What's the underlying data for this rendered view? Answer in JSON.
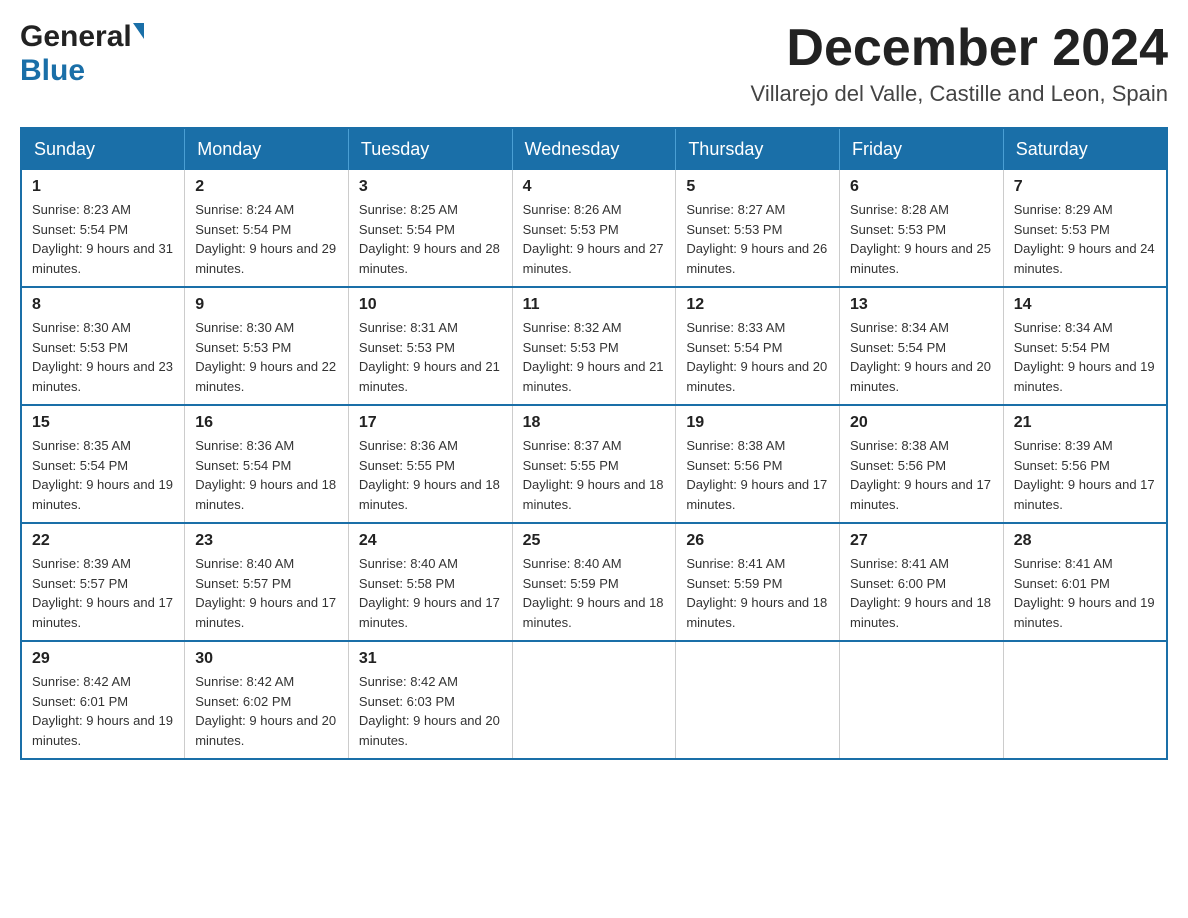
{
  "header": {
    "logo_general": "General",
    "logo_flag_symbol": "▶",
    "logo_blue": "Blue",
    "month_title": "December 2024",
    "location": "Villarejo del Valle, Castille and Leon, Spain"
  },
  "weekdays": [
    "Sunday",
    "Monday",
    "Tuesday",
    "Wednesday",
    "Thursday",
    "Friday",
    "Saturday"
  ],
  "weeks": [
    [
      {
        "day": "1",
        "sunrise": "Sunrise: 8:23 AM",
        "sunset": "Sunset: 5:54 PM",
        "daylight": "Daylight: 9 hours and 31 minutes."
      },
      {
        "day": "2",
        "sunrise": "Sunrise: 8:24 AM",
        "sunset": "Sunset: 5:54 PM",
        "daylight": "Daylight: 9 hours and 29 minutes."
      },
      {
        "day": "3",
        "sunrise": "Sunrise: 8:25 AM",
        "sunset": "Sunset: 5:54 PM",
        "daylight": "Daylight: 9 hours and 28 minutes."
      },
      {
        "day": "4",
        "sunrise": "Sunrise: 8:26 AM",
        "sunset": "Sunset: 5:53 PM",
        "daylight": "Daylight: 9 hours and 27 minutes."
      },
      {
        "day": "5",
        "sunrise": "Sunrise: 8:27 AM",
        "sunset": "Sunset: 5:53 PM",
        "daylight": "Daylight: 9 hours and 26 minutes."
      },
      {
        "day": "6",
        "sunrise": "Sunrise: 8:28 AM",
        "sunset": "Sunset: 5:53 PM",
        "daylight": "Daylight: 9 hours and 25 minutes."
      },
      {
        "day": "7",
        "sunrise": "Sunrise: 8:29 AM",
        "sunset": "Sunset: 5:53 PM",
        "daylight": "Daylight: 9 hours and 24 minutes."
      }
    ],
    [
      {
        "day": "8",
        "sunrise": "Sunrise: 8:30 AM",
        "sunset": "Sunset: 5:53 PM",
        "daylight": "Daylight: 9 hours and 23 minutes."
      },
      {
        "day": "9",
        "sunrise": "Sunrise: 8:30 AM",
        "sunset": "Sunset: 5:53 PM",
        "daylight": "Daylight: 9 hours and 22 minutes."
      },
      {
        "day": "10",
        "sunrise": "Sunrise: 8:31 AM",
        "sunset": "Sunset: 5:53 PM",
        "daylight": "Daylight: 9 hours and 21 minutes."
      },
      {
        "day": "11",
        "sunrise": "Sunrise: 8:32 AM",
        "sunset": "Sunset: 5:53 PM",
        "daylight": "Daylight: 9 hours and 21 minutes."
      },
      {
        "day": "12",
        "sunrise": "Sunrise: 8:33 AM",
        "sunset": "Sunset: 5:54 PM",
        "daylight": "Daylight: 9 hours and 20 minutes."
      },
      {
        "day": "13",
        "sunrise": "Sunrise: 8:34 AM",
        "sunset": "Sunset: 5:54 PM",
        "daylight": "Daylight: 9 hours and 20 minutes."
      },
      {
        "day": "14",
        "sunrise": "Sunrise: 8:34 AM",
        "sunset": "Sunset: 5:54 PM",
        "daylight": "Daylight: 9 hours and 19 minutes."
      }
    ],
    [
      {
        "day": "15",
        "sunrise": "Sunrise: 8:35 AM",
        "sunset": "Sunset: 5:54 PM",
        "daylight": "Daylight: 9 hours and 19 minutes."
      },
      {
        "day": "16",
        "sunrise": "Sunrise: 8:36 AM",
        "sunset": "Sunset: 5:54 PM",
        "daylight": "Daylight: 9 hours and 18 minutes."
      },
      {
        "day": "17",
        "sunrise": "Sunrise: 8:36 AM",
        "sunset": "Sunset: 5:55 PM",
        "daylight": "Daylight: 9 hours and 18 minutes."
      },
      {
        "day": "18",
        "sunrise": "Sunrise: 8:37 AM",
        "sunset": "Sunset: 5:55 PM",
        "daylight": "Daylight: 9 hours and 18 minutes."
      },
      {
        "day": "19",
        "sunrise": "Sunrise: 8:38 AM",
        "sunset": "Sunset: 5:56 PM",
        "daylight": "Daylight: 9 hours and 17 minutes."
      },
      {
        "day": "20",
        "sunrise": "Sunrise: 8:38 AM",
        "sunset": "Sunset: 5:56 PM",
        "daylight": "Daylight: 9 hours and 17 minutes."
      },
      {
        "day": "21",
        "sunrise": "Sunrise: 8:39 AM",
        "sunset": "Sunset: 5:56 PM",
        "daylight": "Daylight: 9 hours and 17 minutes."
      }
    ],
    [
      {
        "day": "22",
        "sunrise": "Sunrise: 8:39 AM",
        "sunset": "Sunset: 5:57 PM",
        "daylight": "Daylight: 9 hours and 17 minutes."
      },
      {
        "day": "23",
        "sunrise": "Sunrise: 8:40 AM",
        "sunset": "Sunset: 5:57 PM",
        "daylight": "Daylight: 9 hours and 17 minutes."
      },
      {
        "day": "24",
        "sunrise": "Sunrise: 8:40 AM",
        "sunset": "Sunset: 5:58 PM",
        "daylight": "Daylight: 9 hours and 17 minutes."
      },
      {
        "day": "25",
        "sunrise": "Sunrise: 8:40 AM",
        "sunset": "Sunset: 5:59 PM",
        "daylight": "Daylight: 9 hours and 18 minutes."
      },
      {
        "day": "26",
        "sunrise": "Sunrise: 8:41 AM",
        "sunset": "Sunset: 5:59 PM",
        "daylight": "Daylight: 9 hours and 18 minutes."
      },
      {
        "day": "27",
        "sunrise": "Sunrise: 8:41 AM",
        "sunset": "Sunset: 6:00 PM",
        "daylight": "Daylight: 9 hours and 18 minutes."
      },
      {
        "day": "28",
        "sunrise": "Sunrise: 8:41 AM",
        "sunset": "Sunset: 6:01 PM",
        "daylight": "Daylight: 9 hours and 19 minutes."
      }
    ],
    [
      {
        "day": "29",
        "sunrise": "Sunrise: 8:42 AM",
        "sunset": "Sunset: 6:01 PM",
        "daylight": "Daylight: 9 hours and 19 minutes."
      },
      {
        "day": "30",
        "sunrise": "Sunrise: 8:42 AM",
        "sunset": "Sunset: 6:02 PM",
        "daylight": "Daylight: 9 hours and 20 minutes."
      },
      {
        "day": "31",
        "sunrise": "Sunrise: 8:42 AM",
        "sunset": "Sunset: 6:03 PM",
        "daylight": "Daylight: 9 hours and 20 minutes."
      },
      null,
      null,
      null,
      null
    ]
  ]
}
